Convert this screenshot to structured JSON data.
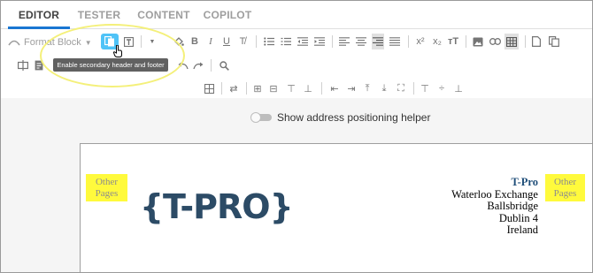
{
  "tabs": [
    {
      "label": "EDITOR",
      "active": true
    },
    {
      "label": "TESTER",
      "active": false
    },
    {
      "label": "CONTENT",
      "active": false
    },
    {
      "label": "COPILOT",
      "active": false
    }
  ],
  "toolbar": {
    "format_block": "Format Block",
    "tooltip": "Enable secondary header and footer"
  },
  "helper": {
    "label": "Show address positioning helper",
    "enabled": false
  },
  "document": {
    "other_pages_left": "Other Pages",
    "other_pages_right": "Other Pages",
    "logo_text": "{T-PRO}",
    "address": {
      "company": "T-Pro",
      "line1": "Waterloo Exchange",
      "line2": "Ballsbridge",
      "line3": "Dublin 4",
      "line4": "Ireland"
    }
  },
  "colors": {
    "accent": "#1976d2",
    "highlight_button": "#4fc3f7",
    "other_pages_bg": "#fffa3c",
    "logo": "#2c4b66",
    "annotation_ellipse": "#f4f07a"
  }
}
